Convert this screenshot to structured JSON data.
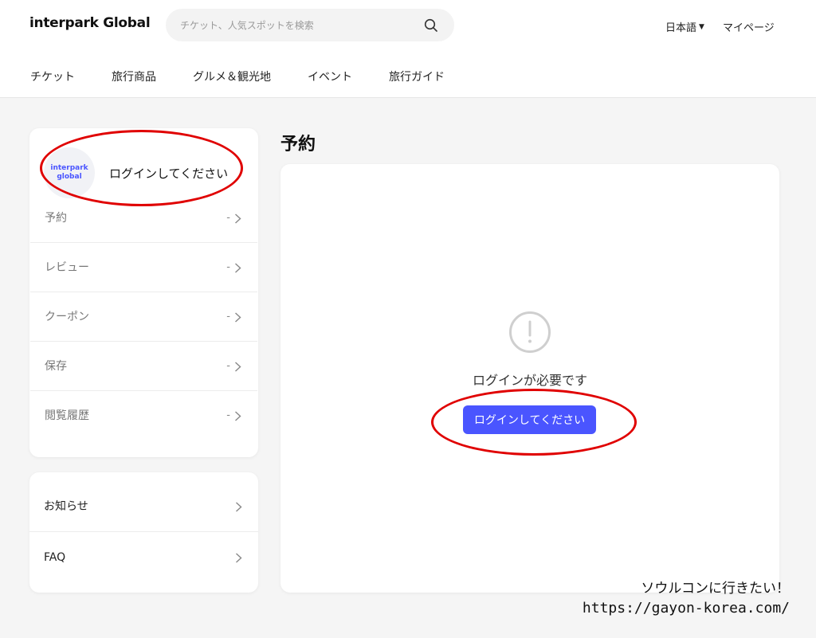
{
  "header": {
    "logo": "interpark Global",
    "search": {
      "placeholder": "チケット、人気スポットを検索"
    },
    "language": "日本語",
    "mypage": "マイページ"
  },
  "nav": {
    "items": [
      "チケット",
      "旅行商品",
      "グルメ＆観光地",
      "イベント",
      "旅行ガイド"
    ]
  },
  "sidebar": {
    "avatar_lines": [
      "interpark",
      "global"
    ],
    "login_prompt": "ログインしてください",
    "menu": [
      {
        "label": "予約",
        "count": "-"
      },
      {
        "label": "レビュー",
        "count": "-"
      },
      {
        "label": "クーポン",
        "count": "-"
      },
      {
        "label": "保存",
        "count": "-"
      },
      {
        "label": "閲覧履歴",
        "count": "-"
      }
    ],
    "info": [
      {
        "label": "お知らせ"
      },
      {
        "label": "FAQ"
      }
    ]
  },
  "main": {
    "title": "予約",
    "empty_message": "ログインが必要です",
    "login_button": "ログインしてください"
  },
  "watermark": {
    "line1": "ソウルコンに行きたい！",
    "line2": "https://gayon-korea.com/"
  },
  "colors": {
    "accent": "#4a55ff",
    "annotation": "#e00000"
  }
}
